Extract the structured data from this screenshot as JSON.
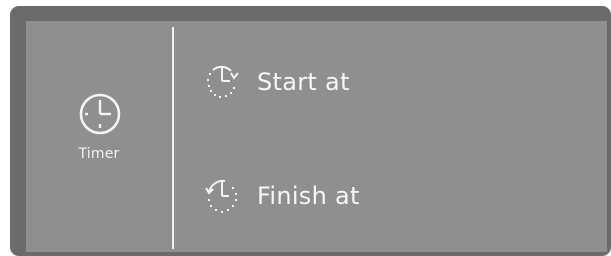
{
  "timer": {
    "label": "Timer",
    "icon": "clock-icon"
  },
  "menu": {
    "items": [
      {
        "label": "Start at",
        "icon": "start-at-clock-icon"
      },
      {
        "label": "Finish at",
        "icon": "finish-at-clock-icon"
      }
    ]
  },
  "colors": {
    "bezel": "#6b6b6b",
    "screen": "#8f8f8f",
    "foreground": "#f6f6f6"
  }
}
